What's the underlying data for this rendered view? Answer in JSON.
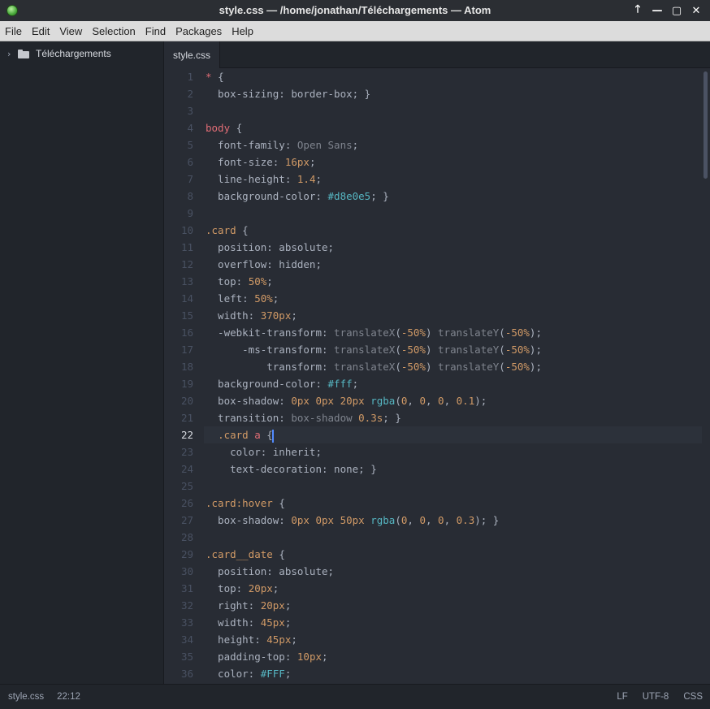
{
  "window": {
    "title": "style.css — /home/jonathan/Téléchargements — Atom",
    "controls": [
      "🡑",
      "—",
      "▢",
      "✕"
    ]
  },
  "menu": [
    "File",
    "Edit",
    "View",
    "Selection",
    "Find",
    "Packages",
    "Help"
  ],
  "tree": {
    "root": "Téléchargements"
  },
  "tabs": [
    {
      "label": "style.css"
    }
  ],
  "editor": {
    "active_line": 22,
    "lines": [
      "1",
      "2",
      "3",
      "4",
      "5",
      "6",
      "7",
      "8",
      "9",
      "10",
      "11",
      "12",
      "13",
      "14",
      "15",
      "16",
      "17",
      "18",
      "19",
      "20",
      "21",
      "22",
      "23",
      "24",
      "25",
      "26",
      "27",
      "28",
      "29",
      "30",
      "31",
      "32",
      "33",
      "34",
      "35",
      "36"
    ]
  },
  "status": {
    "file": "style.css",
    "cursor": "22:12",
    "line_ending": "LF",
    "encoding": "UTF-8",
    "grammar": "CSS"
  }
}
